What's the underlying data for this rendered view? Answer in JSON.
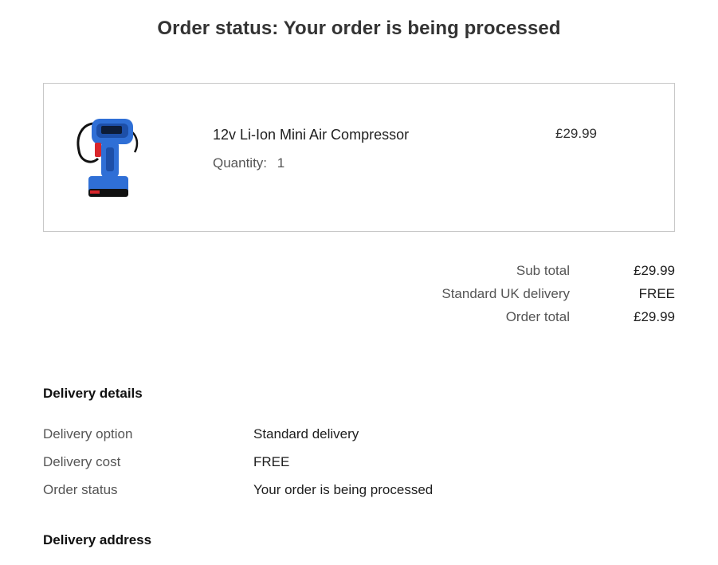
{
  "page": {
    "title": "Order status:  Your order is being processed"
  },
  "item": {
    "name": "12v Li-Ion Mini Air Compressor",
    "quantity_label": "Quantity:",
    "quantity": "1",
    "price": "£29.99",
    "image_icon": "air-compressor-product-image",
    "brand_color": "#2f6fd6"
  },
  "summary": [
    {
      "label": "Sub total",
      "value": "£29.99"
    },
    {
      "label": "Standard UK delivery",
      "value": "FREE"
    },
    {
      "label": "Order total",
      "value": "£29.99"
    }
  ],
  "delivery_details": {
    "heading": "Delivery details",
    "rows": [
      {
        "label": "Delivery option",
        "value": "Standard delivery"
      },
      {
        "label": "Delivery cost",
        "value": "FREE"
      },
      {
        "label": "Order status",
        "value": "Your order is being processed"
      }
    ]
  },
  "delivery_address": {
    "heading": "Delivery address"
  }
}
